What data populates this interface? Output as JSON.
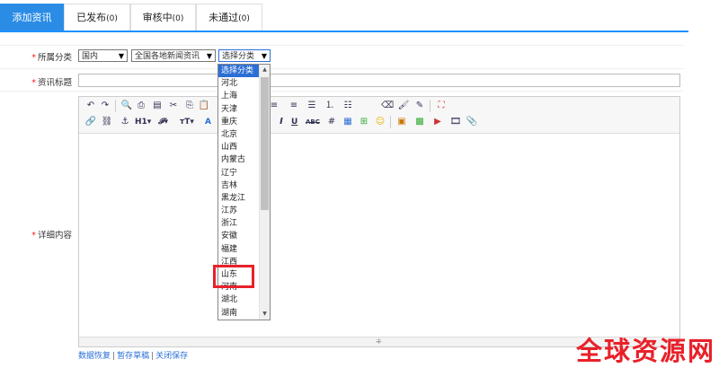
{
  "tabs": [
    {
      "label": "添加资讯",
      "count": ""
    },
    {
      "label": "已发布",
      "count": "(0)"
    },
    {
      "label": "审核中",
      "count": "(0)"
    },
    {
      "label": "未通过",
      "count": "(0)"
    }
  ],
  "form": {
    "category_label": "所属分类",
    "title_label": "资讯标题",
    "content_label": "详细内容",
    "required_mark": "*",
    "select_region": "国内",
    "select_channel": "全国各地新闻资讯",
    "select_category": "选择分类",
    "title_value": ""
  },
  "editor": {
    "toolbar_text": {
      "h1": "H1",
      "font": "𝓕",
      "size": "тT",
      "bold_a": "A",
      "u": "U",
      "abc": "ABC"
    },
    "resize_handle": "⁜"
  },
  "dropdown": {
    "items": [
      "选择分类",
      "河北",
      "上海",
      "天津",
      "重庆",
      "北京",
      "山西",
      "内蒙古",
      "辽宁",
      "吉林",
      "黑龙江",
      "江苏",
      "浙江",
      "安徽",
      "福建",
      "江西",
      "山东",
      "河南",
      "湖北",
      "湖南"
    ],
    "selected_index": 0,
    "highlighted_item": "山东"
  },
  "footer": {
    "restore": "数据恢复",
    "save_draft": "暂存草稿",
    "close_save": "关闭保存",
    "divider": "|"
  },
  "watermark": "全球资源网",
  "colors": {
    "accent": "#2b8ce6",
    "highlight_box": "#e8212a",
    "selected_option": "#2b6fd6"
  }
}
